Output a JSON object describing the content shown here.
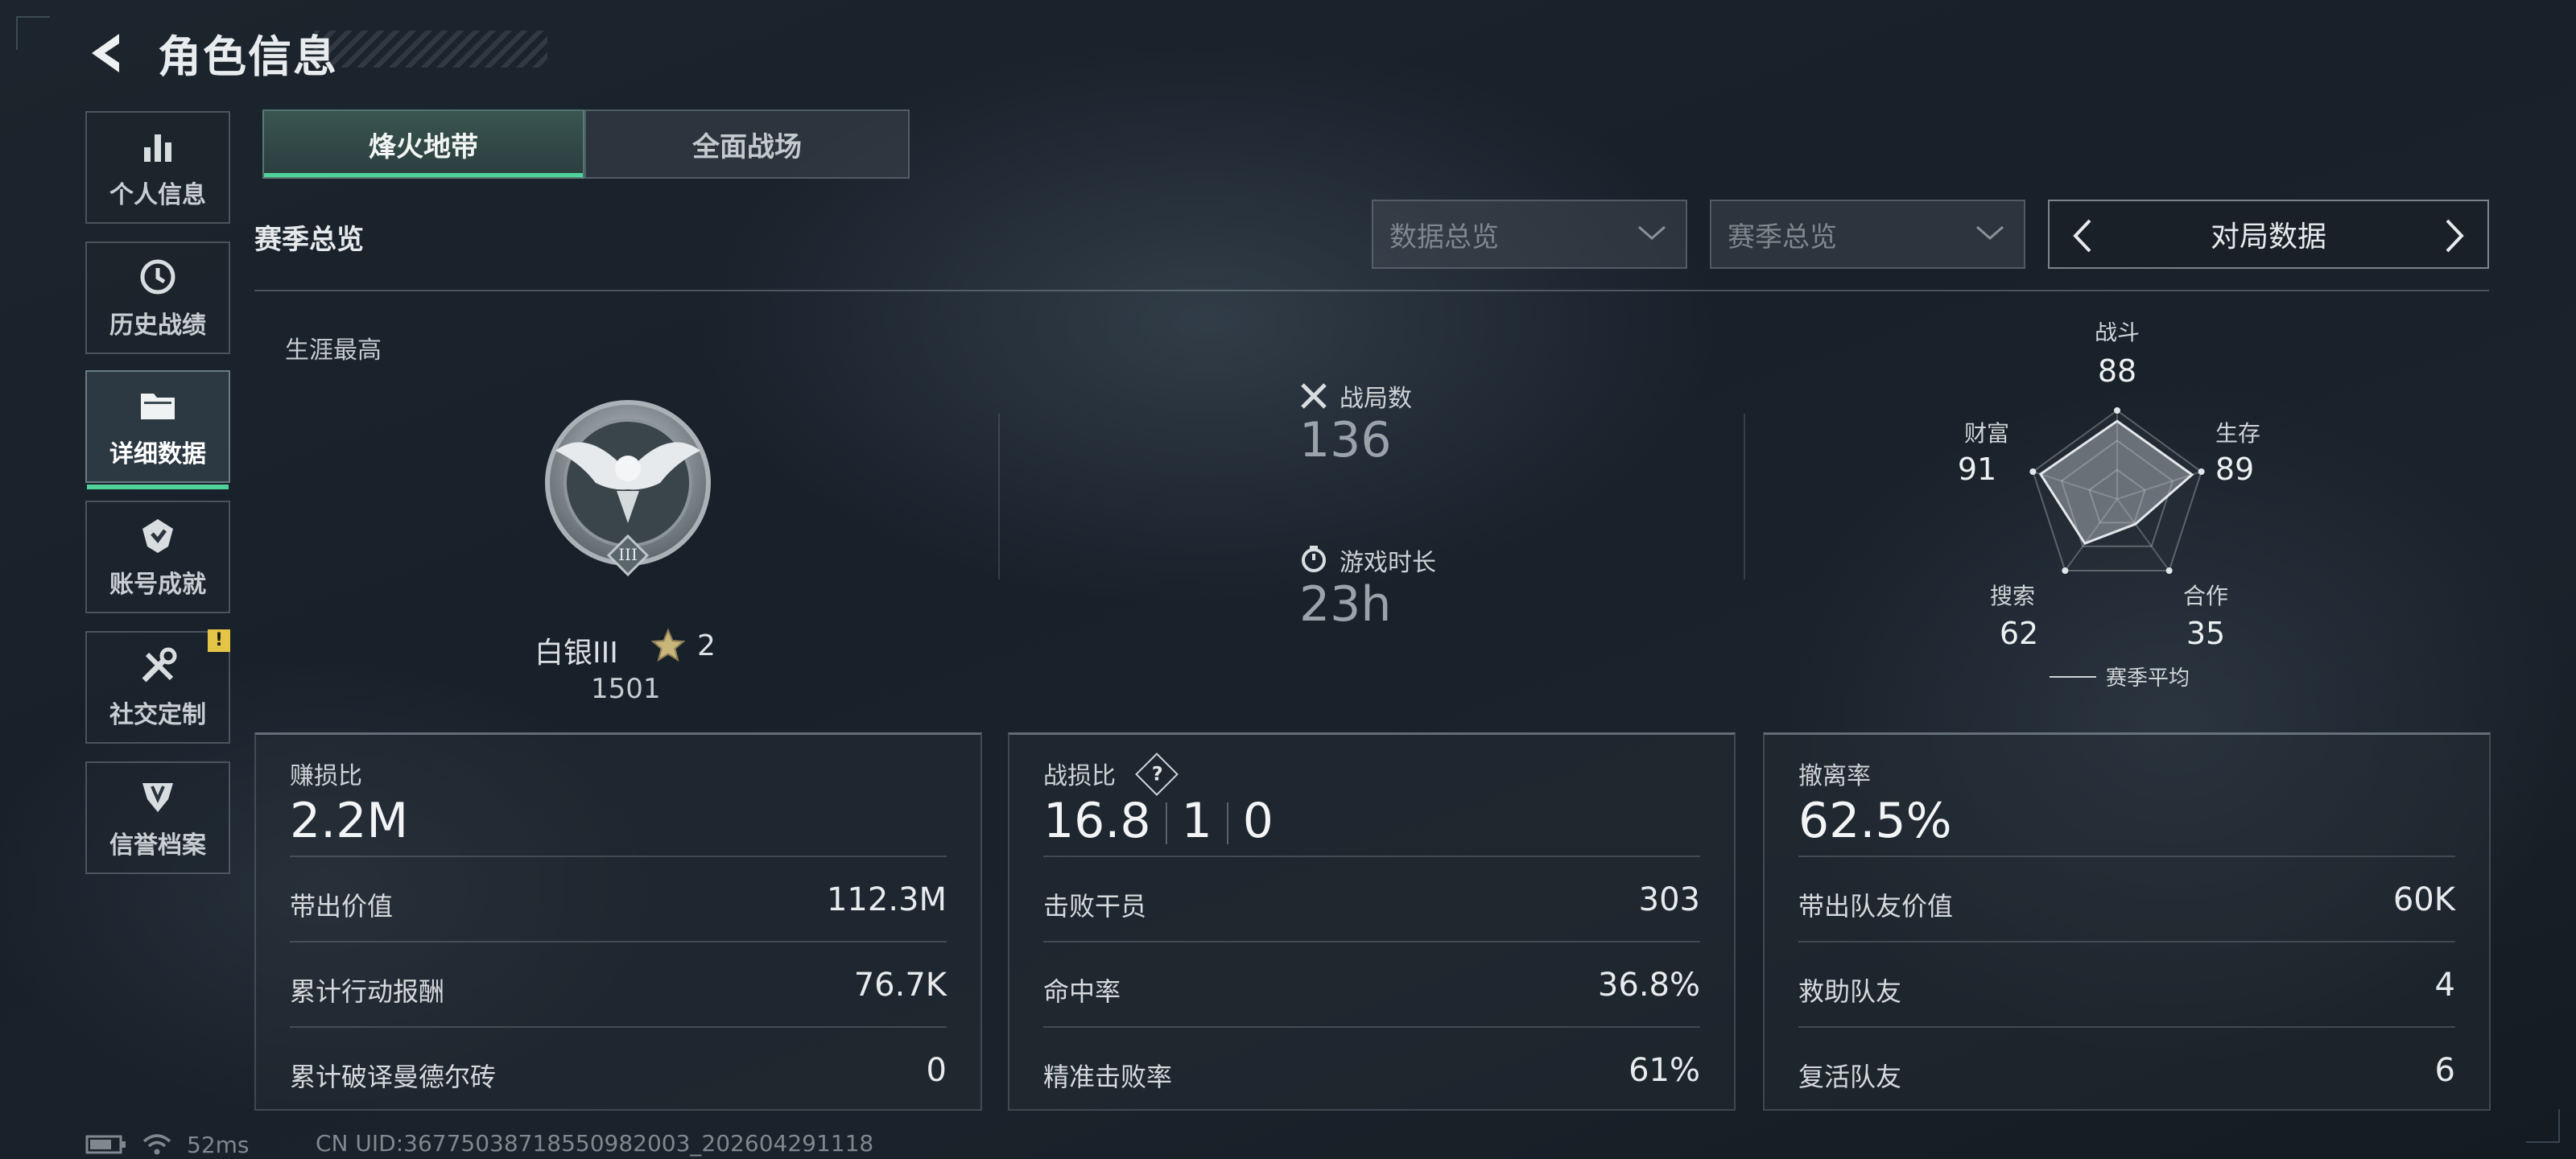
{
  "header": {
    "title": "角色信息"
  },
  "sidebar": {
    "items": [
      {
        "label": "个人信息",
        "icon": "bar-chart-icon"
      },
      {
        "label": "历史战绩",
        "icon": "history-clock-icon"
      },
      {
        "label": "详细数据",
        "icon": "folder-icon",
        "active": true
      },
      {
        "label": "账号成就",
        "icon": "achievement-icon"
      },
      {
        "label": "社交定制",
        "icon": "tools-icon",
        "badge": "!"
      },
      {
        "label": "信誉档案",
        "icon": "credit-shield-icon"
      }
    ]
  },
  "tabs": [
    {
      "label": "烽火地带",
      "active": true
    },
    {
      "label": "全面战场",
      "active": false
    }
  ],
  "section": {
    "title": "赛季总览",
    "dropdown1": "数据总览",
    "dropdown2": "赛季总览",
    "switcher": "对局数据"
  },
  "career": {
    "label": "生涯最高",
    "rank_name": "白银III",
    "stars": "2",
    "score": "1501",
    "medal_numeral": "III"
  },
  "summary": {
    "matches_label": "战局数",
    "matches_value": "136",
    "playtime_label": "游戏时长",
    "playtime_value": "23h"
  },
  "radar": {
    "axes": [
      {
        "label": "战斗",
        "value": "88",
        "score": 88
      },
      {
        "label": "生存",
        "value": "89",
        "score": 89
      },
      {
        "label": "合作",
        "value": "35",
        "score": 35
      },
      {
        "label": "搜索",
        "value": "62",
        "score": 62
      },
      {
        "label": "财富",
        "value": "91",
        "score": 91
      }
    ],
    "legend": "赛季平均"
  },
  "panels": [
    {
      "title": "赚损比",
      "big": "2.2M",
      "rows": [
        {
          "k": "带出价值",
          "v": "112.3M"
        },
        {
          "k": "累计行动报酬",
          "v": "76.7K"
        },
        {
          "k": "累计破译曼德尔砖",
          "v": "0"
        }
      ]
    },
    {
      "title": "战损比",
      "help": "?",
      "big_parts": [
        "16.8",
        "1",
        "0"
      ],
      "rows": [
        {
          "k": "击败干员",
          "v": "303"
        },
        {
          "k": "命中率",
          "v": "36.8%"
        },
        {
          "k": "精准击败率",
          "v": "61%"
        }
      ]
    },
    {
      "title": "撤离率",
      "big": "62.5%",
      "rows": [
        {
          "k": "带出队友价值",
          "v": "60K"
        },
        {
          "k": "救助队友",
          "v": "4"
        },
        {
          "k": "复活队友",
          "v": "6"
        }
      ]
    }
  ],
  "status": {
    "ping": "52ms",
    "uid": "CN UID:36775038718550982003_202604291118"
  },
  "colors": {
    "accent": "#4fd39a",
    "badge": "#e5c545"
  }
}
